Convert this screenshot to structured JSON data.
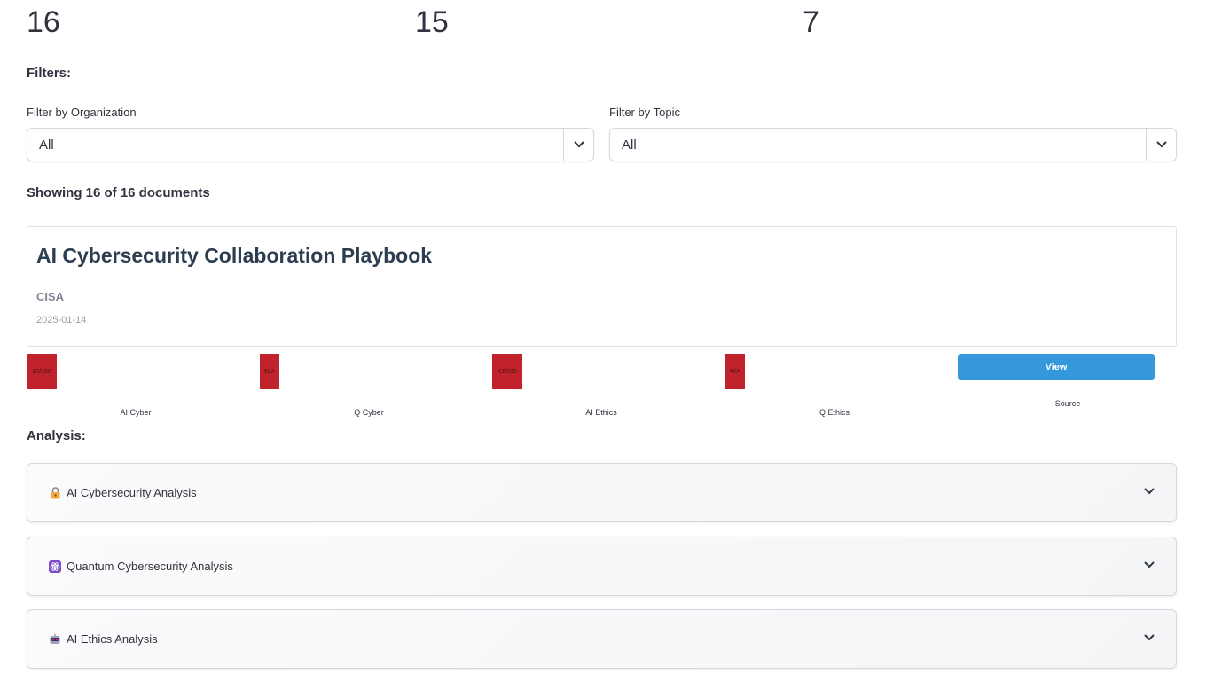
{
  "metrics": [
    "16",
    "15",
    "7"
  ],
  "filters": {
    "heading": "Filters:",
    "organization": {
      "label": "Filter by Organization",
      "value": "All"
    },
    "topic": {
      "label": "Filter by Topic",
      "value": "All"
    }
  },
  "showing": "Showing 16 of 16 documents",
  "document": {
    "title": "AI Cybersecurity Collaboration Playbook",
    "organization": "CISA",
    "date": "2025-01-14"
  },
  "scores": [
    {
      "value": "30/100",
      "label": "AI Cyber"
    },
    {
      "value": "N/A",
      "label": "Q Cyber"
    },
    {
      "value": "43/100",
      "label": "AI Ethics"
    },
    {
      "value": "N/A",
      "label": "Q Ethics"
    }
  ],
  "source": {
    "button": "View",
    "label": "Source"
  },
  "analysis": {
    "heading": "Analysis:",
    "sections": [
      {
        "icon": "lock-icon",
        "label": "AI Cybersecurity Analysis"
      },
      {
        "icon": "atom-icon",
        "label": "Quantum Cybersecurity Analysis"
      },
      {
        "icon": "robot-icon",
        "label": "AI Ethics Analysis"
      }
    ]
  },
  "colors": {
    "score_bg": "#c0232b",
    "view_button": "#3498db",
    "title": "#2c3e50"
  }
}
